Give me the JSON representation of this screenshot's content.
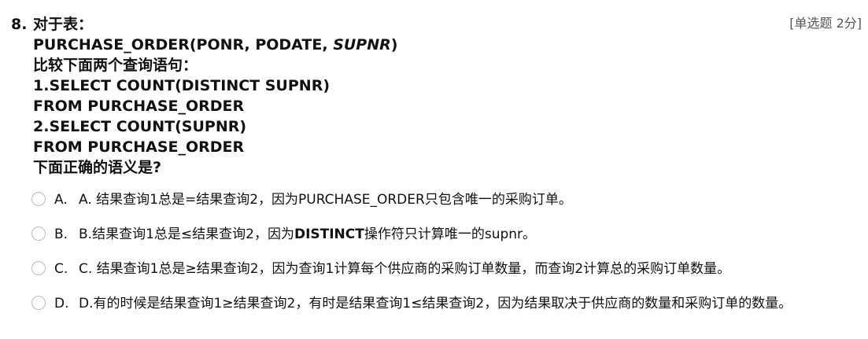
{
  "question": {
    "number": "8.",
    "type_label": "[单选题 2分]",
    "stem": {
      "line1": "对于表：",
      "line2_prefix": "PURCHASE_ORDER(PONR, PODATE, ",
      "line2_italic": "SUPNR",
      "line2_suffix": ")",
      "line3": "比较下面两个查询语句：",
      "line4": "1.SELECT COUNT(DISTINCT SUPNR)",
      "line5": "FROM PURCHASE_ORDER",
      "line6": "2.SELECT COUNT(SUPNR)",
      "line7": "FROM PURCHASE_ORDER",
      "line8": "下面正确的语义是?"
    },
    "options": [
      {
        "letter": "A.",
        "text": "A. 结果查询1总是=结果查询2，因为PURCHASE_ORDER只包含唯一的采购订单。"
      },
      {
        "letter": "B.",
        "text_before": "B.结果查询1总是≤结果查询2，因为",
        "text_bold": "DISTINCT",
        "text_after": "操作符只计算唯一的supnr。"
      },
      {
        "letter": "C.",
        "text": "C. 结果查询1总是≥结果查询2，因为查询1计算每个供应商的采购订单数量，而查询2计算总的采购订单数量。"
      },
      {
        "letter": "D.",
        "text": "D.有的时候是结果查询1≥结果查询2，有时是结果查询1≤结果查询2，因为结果取决于供应商的数量和采购订单的数量。"
      }
    ]
  }
}
